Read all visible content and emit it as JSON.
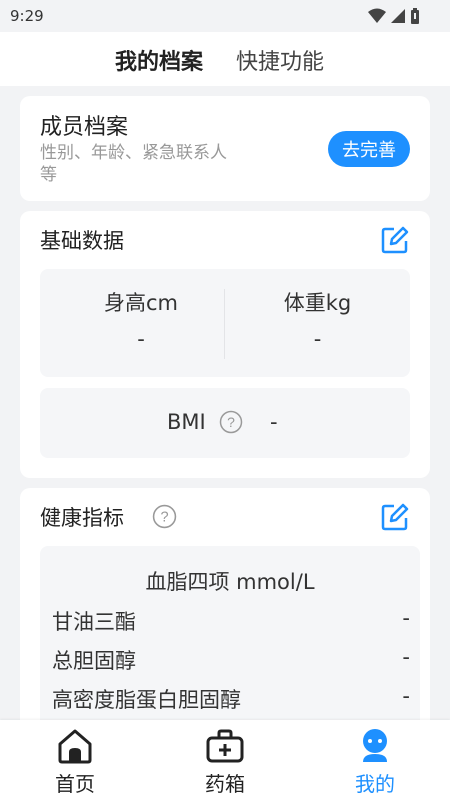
{
  "status_bar": {
    "time": "9:29"
  },
  "header": {
    "tabs": [
      {
        "label": "我的档案"
      },
      {
        "label": "快捷功能"
      }
    ]
  },
  "member": {
    "title": "成员档案",
    "subtitle": "性别、年龄、紧急联系人等",
    "button": "去完善"
  },
  "basic": {
    "title": "基础数据",
    "height_label": "身高cm",
    "height_value": "-",
    "weight_label": "体重kg",
    "weight_value": "-",
    "bmi_label": "BMI",
    "bmi_value": "-"
  },
  "health": {
    "title": "健康指标",
    "lipid_title": "血脂四项 mmol/L",
    "rows": [
      {
        "label": "甘油三酯",
        "value": "-"
      },
      {
        "label": "总胆固醇",
        "value": "-"
      },
      {
        "label": "高密度脂蛋白胆固醇",
        "value": "-"
      }
    ]
  },
  "nav": {
    "items": [
      {
        "label": "首页"
      },
      {
        "label": "药箱"
      },
      {
        "label": "我的"
      }
    ],
    "active_color": "#1e90ff"
  }
}
